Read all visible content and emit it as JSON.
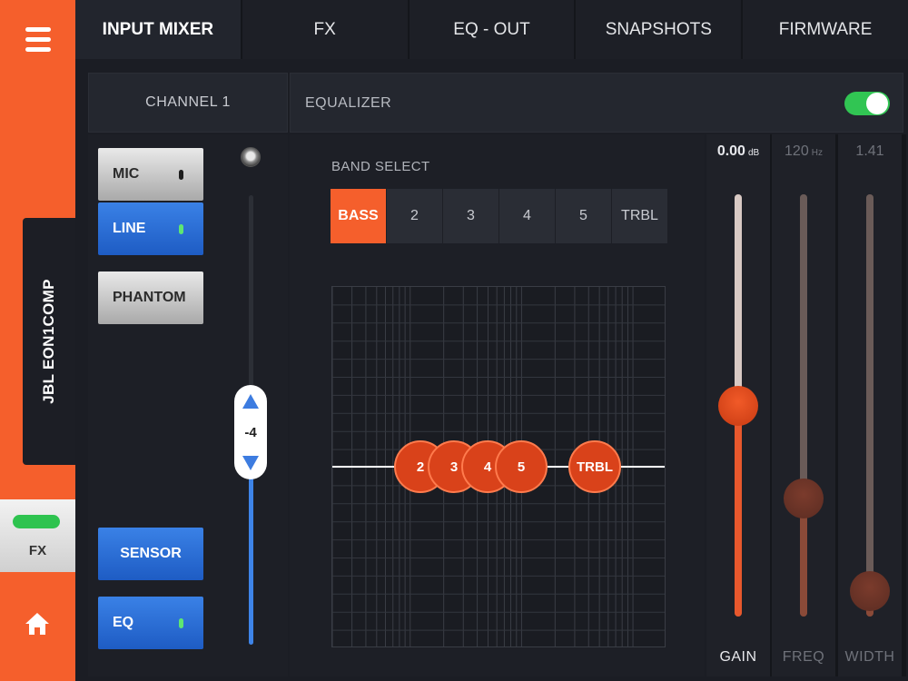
{
  "device": {
    "name": "JBL EON1COMP"
  },
  "sidebar": {
    "fx_label": "FX"
  },
  "tabs": [
    {
      "label": "INPUT MIXER",
      "active": true
    },
    {
      "label": "FX",
      "active": false
    },
    {
      "label": "EQ - OUT",
      "active": false
    },
    {
      "label": "SNAPSHOTS",
      "active": false
    },
    {
      "label": "FIRMWARE",
      "active": false
    }
  ],
  "channel": {
    "title": "CHANNEL 1",
    "buttons": {
      "mic": "MIC",
      "line": "LINE",
      "phantom": "PHANTOM",
      "sensor": "SENSOR",
      "eq": "EQ"
    },
    "gain_value": "-4"
  },
  "equalizer": {
    "title": "EQUALIZER",
    "enabled": true,
    "band_select_label": "BAND SELECT",
    "bands": [
      "BASS",
      "2",
      "3",
      "4",
      "5",
      "TRBL"
    ],
    "selected_band": "BASS",
    "nodes": [
      "2",
      "3",
      "4",
      "5",
      "TRBL"
    ]
  },
  "params": {
    "gain": {
      "value": "0.00",
      "unit": "dB",
      "label": "GAIN",
      "level": 0.5
    },
    "freq": {
      "value": "120",
      "unit": "Hz",
      "label": "FREQ",
      "level": 0.28
    },
    "width": {
      "value": "1.41",
      "unit": "",
      "label": "WIDTH",
      "level": 0.06
    }
  },
  "colors": {
    "accent": "#f55f2c",
    "toggle_on": "#31c553",
    "blue": "#2f70dc"
  }
}
